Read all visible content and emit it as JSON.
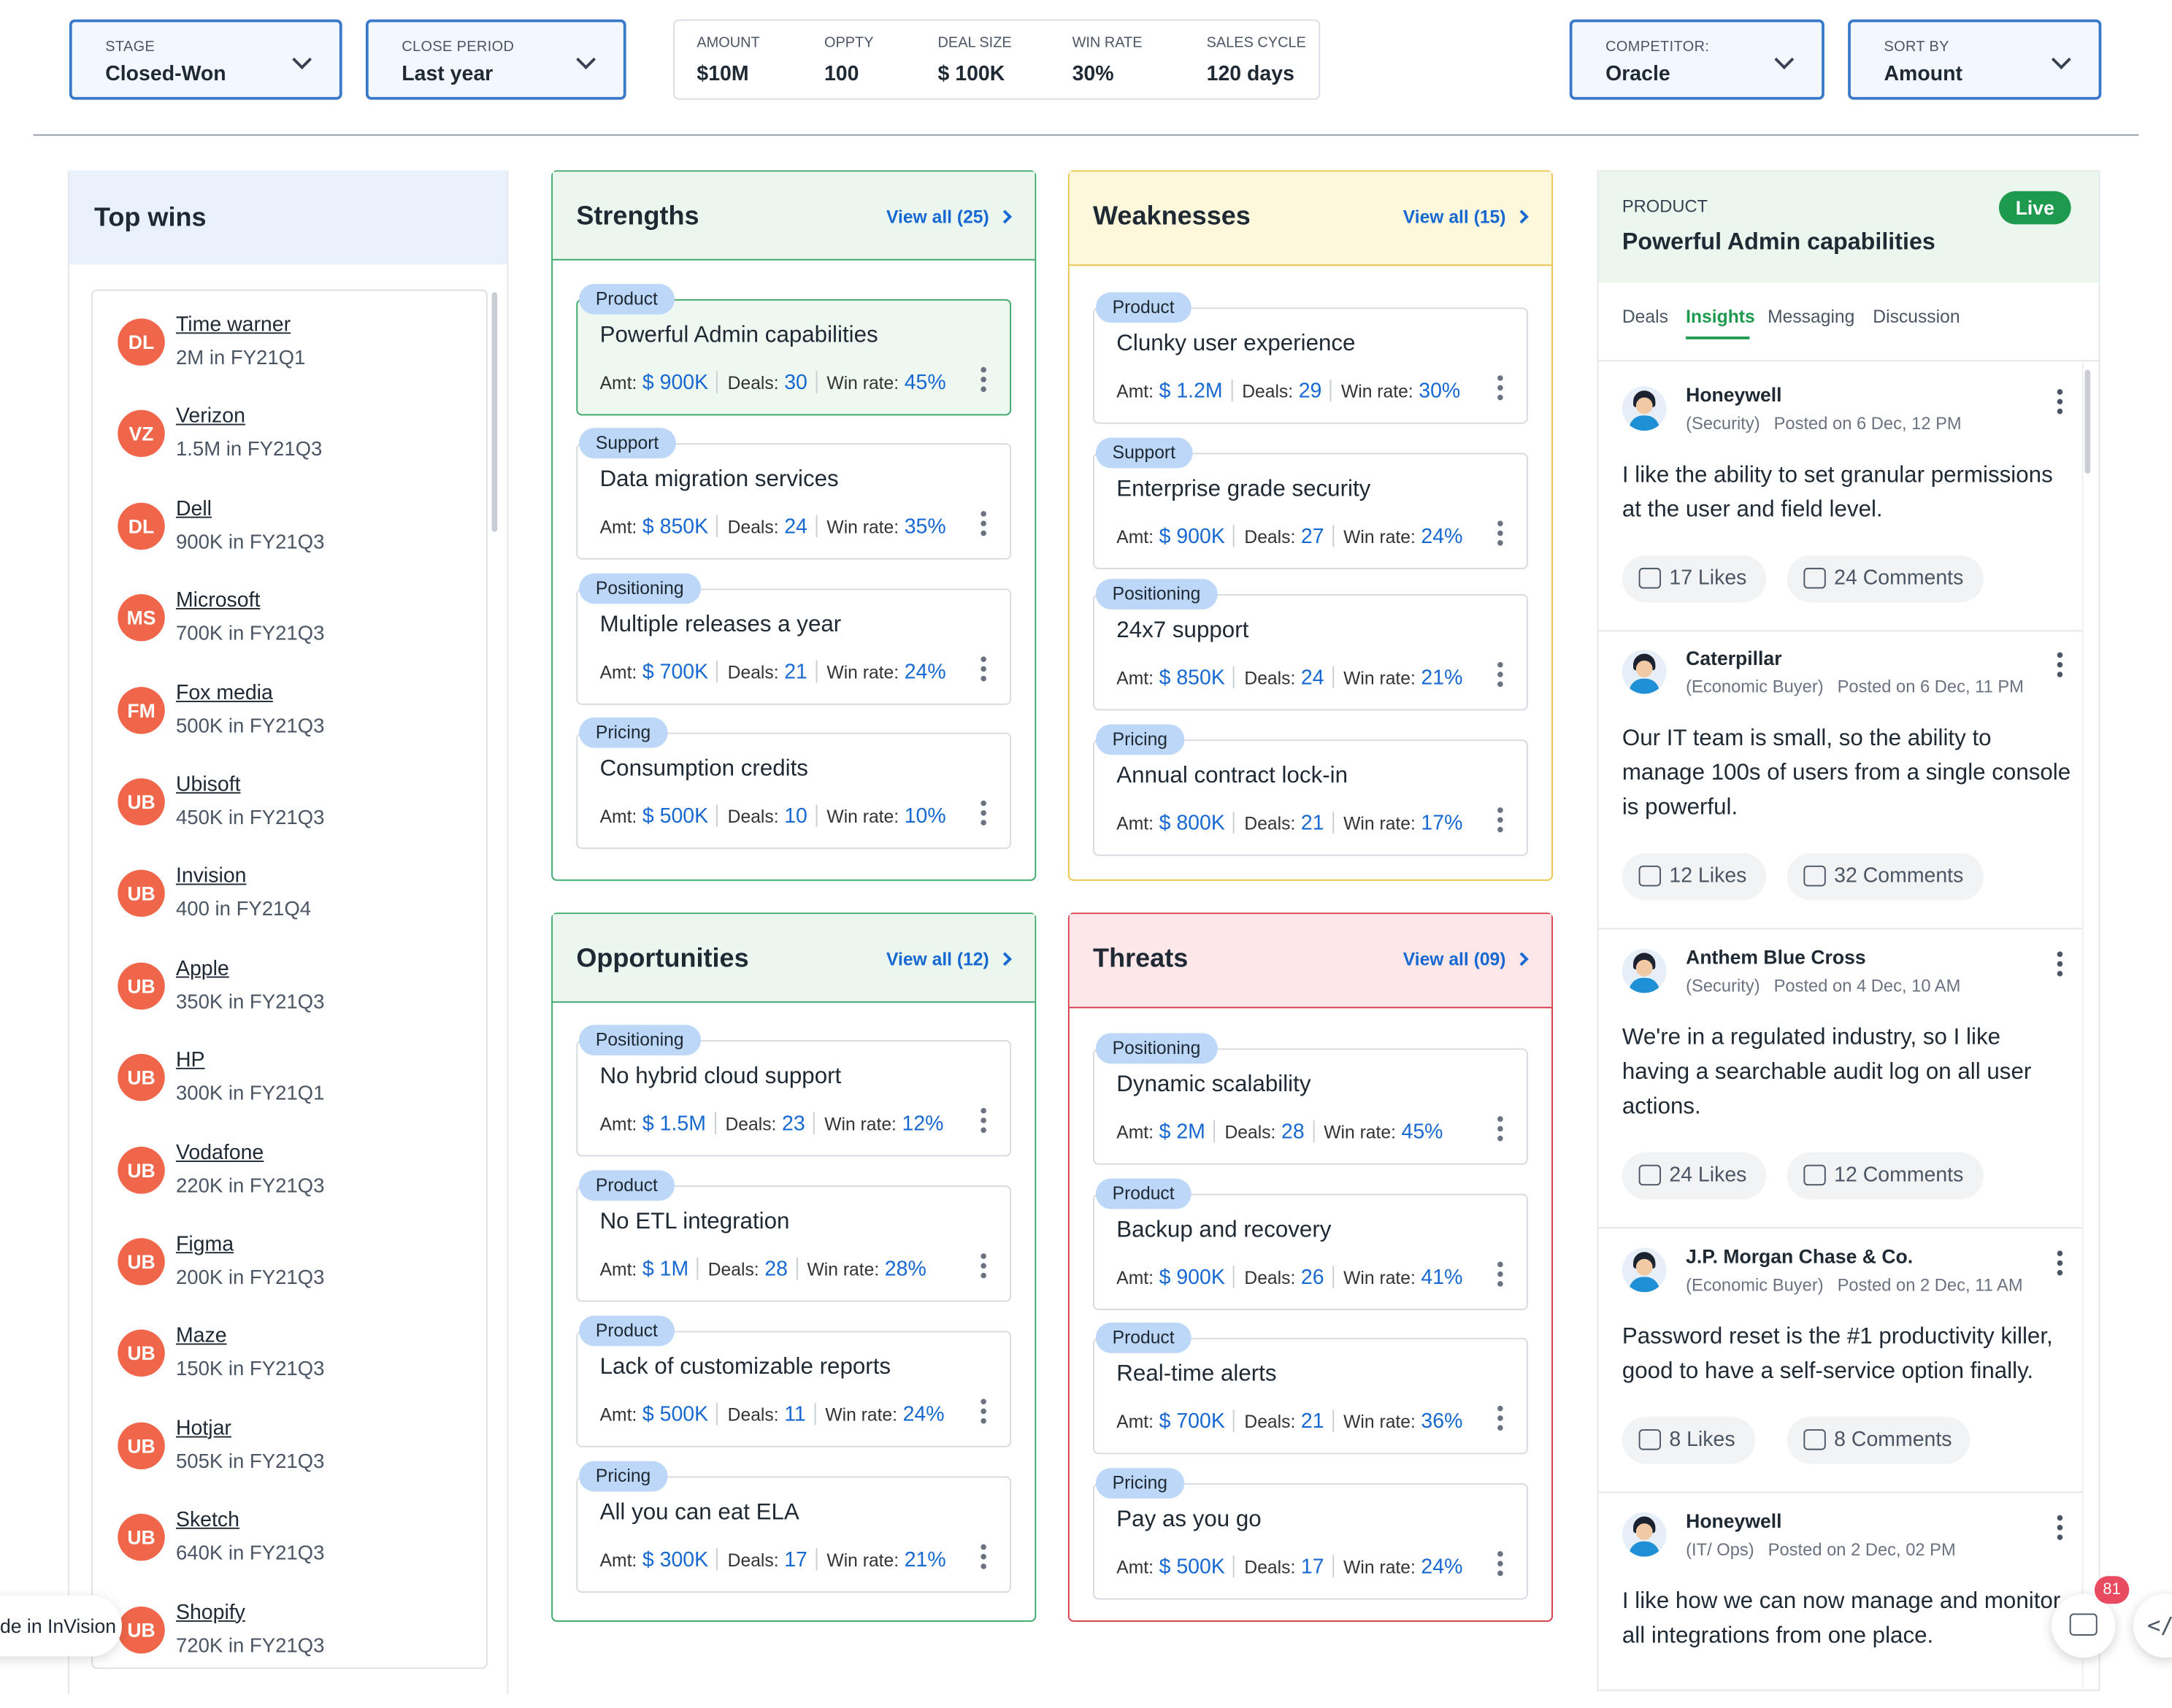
{
  "filters": {
    "stage": {
      "label": "STAGE",
      "value": "Closed-Won"
    },
    "close_period": {
      "label": "CLOSE PERIOD",
      "value": "Last year"
    },
    "competitor": {
      "label": "COMPETITOR:",
      "value": "Oracle"
    },
    "sort_by": {
      "label": "SORT BY",
      "value": "Amount"
    }
  },
  "metrics": [
    {
      "label": "AMOUNT",
      "value": "$10M"
    },
    {
      "label": "OPPTY",
      "value": "100"
    },
    {
      "label": "DEAL SIZE",
      "value": "$ 100K"
    },
    {
      "label": "WIN RATE",
      "value": "30%"
    },
    {
      "label": "SALES CYCLE",
      "value": "120 days"
    }
  ],
  "top_wins": {
    "title": "Top wins",
    "items": [
      {
        "initials": "DL",
        "name": "Time warner",
        "detail": "2M in FY21Q1"
      },
      {
        "initials": "VZ",
        "name": "Verizon",
        "detail": "1.5M in FY21Q3"
      },
      {
        "initials": "DL",
        "name": "Dell",
        "detail": "900K in FY21Q3"
      },
      {
        "initials": "MS",
        "name": "Microsoft",
        "detail": "700K in FY21Q3"
      },
      {
        "initials": "FM",
        "name": "Fox media",
        "detail": "500K in FY21Q3"
      },
      {
        "initials": "UB",
        "name": "Ubisoft",
        "detail": "450K in FY21Q3"
      },
      {
        "initials": "UB",
        "name": "Invision",
        "detail": "400 in FY21Q4"
      },
      {
        "initials": "UB",
        "name": "Apple",
        "detail": "350K in FY21Q3"
      },
      {
        "initials": "UB",
        "name": "HP",
        "detail": "300K in FY21Q1"
      },
      {
        "initials": "UB",
        "name": "Vodafone",
        "detail": "220K in FY21Q3"
      },
      {
        "initials": "UB",
        "name": "Figma",
        "detail": "200K in FY21Q3"
      },
      {
        "initials": "UB",
        "name": "Maze",
        "detail": "150K in FY21Q3"
      },
      {
        "initials": "UB",
        "name": "Hotjar",
        "detail": "505K in FY21Q3"
      },
      {
        "initials": "UB",
        "name": "Sketch",
        "detail": "640K in FY21Q3"
      },
      {
        "initials": "UB",
        "name": "Shopify",
        "detail": "720K in FY21Q3"
      }
    ]
  },
  "card_labels": {
    "amt": "Amt:",
    "deals": "Deals:",
    "win_rate": "Win rate:"
  },
  "panels": {
    "strengths": {
      "title": "Strengths",
      "view_all": "View all (25)",
      "cards": [
        {
          "tag": "Product",
          "title": "Powerful Admin capabilities",
          "amt": "$ 900K",
          "deals": "30",
          "win_rate": "45%"
        },
        {
          "tag": "Support",
          "title": "Data migration services",
          "amt": "$ 850K",
          "deals": "24",
          "win_rate": "35%"
        },
        {
          "tag": "Positioning",
          "title": "Multiple releases a year",
          "amt": "$ 700K",
          "deals": "21",
          "win_rate": "24%"
        },
        {
          "tag": "Pricing",
          "title": "Consumption credits",
          "amt": "$ 500K",
          "deals": "10",
          "win_rate": "10%"
        }
      ]
    },
    "weaknesses": {
      "title": "Weaknesses",
      "view_all": "View all (15)",
      "cards": [
        {
          "tag": "Product",
          "title": "Clunky user experience",
          "amt": "$ 1.2M",
          "deals": "29",
          "win_rate": "30%"
        },
        {
          "tag": "Support",
          "title": "Enterprise grade security",
          "amt": "$ 900K",
          "deals": "27",
          "win_rate": "24%"
        },
        {
          "tag": "Positioning",
          "title": "24x7 support",
          "amt": "$ 850K",
          "deals": "24",
          "win_rate": "21%"
        },
        {
          "tag": "Pricing",
          "title": "Annual contract lock-in",
          "amt": "$ 800K",
          "deals": "21",
          "win_rate": "17%"
        }
      ]
    },
    "opportunities": {
      "title": "Opportunities",
      "view_all": "View all (12)",
      "cards": [
        {
          "tag": "Positioning",
          "title": "No hybrid cloud support",
          "amt": "$ 1.5M",
          "deals": "23",
          "win_rate": "12%"
        },
        {
          "tag": "Product",
          "title": "No ETL integration",
          "amt": "$ 1M",
          "deals": "28",
          "win_rate": "28%"
        },
        {
          "tag": "Product",
          "title": "Lack of customizable reports",
          "amt": "$ 500K",
          "deals": "11",
          "win_rate": "24%"
        },
        {
          "tag": "Pricing",
          "title": "All you can eat ELA",
          "amt": "$ 300K",
          "deals": "17",
          "win_rate": "21%"
        }
      ]
    },
    "threats": {
      "title": "Threats",
      "view_all": "View all (09)",
      "cards": [
        {
          "tag": "Positioning",
          "title": "Dynamic scalability",
          "amt": "$ 2M",
          "deals": "28",
          "win_rate": "45%"
        },
        {
          "tag": "Product",
          "title": "Backup and recovery",
          "amt": "$ 900K",
          "deals": "26",
          "win_rate": "41%"
        },
        {
          "tag": "Product",
          "title": "Real-time alerts",
          "amt": "$ 700K",
          "deals": "21",
          "win_rate": "36%"
        },
        {
          "tag": "Pricing",
          "title": "Pay as you go",
          "amt": "$ 500K",
          "deals": "17",
          "win_rate": "24%"
        }
      ]
    }
  },
  "detail": {
    "category": "PRODUCT",
    "title": "Powerful Admin capabilities",
    "status": "Live",
    "tabs": [
      "Deals",
      "Insights",
      "Messaging",
      "Discussion"
    ],
    "active_tab": "Insights",
    "posts": [
      {
        "author": "Honeywell",
        "role": "(Security)",
        "posted": "Posted on 6 Dec, 12 PM",
        "text": "I like the ability to set granular permissions at the user and field level.",
        "likes": "17 Likes",
        "comments": "24 Comments"
      },
      {
        "author": "Caterpillar",
        "role": "(Economic Buyer)",
        "posted": "Posted on 6 Dec, 11 PM",
        "text": "Our IT team is small, so the ability to manage 100s of users from a single console is powerful.",
        "likes": "12 Likes",
        "comments": "32 Comments"
      },
      {
        "author": "Anthem Blue Cross",
        "role": "(Security)",
        "posted": "Posted on 4 Dec, 10 AM",
        "text": "We're in a regulated industry, so I like having a searchable audit log on all user actions.",
        "likes": "24 Likes",
        "comments": "12 Comments"
      },
      {
        "author": "J.P. Morgan Chase & Co.",
        "role": "(Economic Buyer)",
        "posted": "Posted on 2 Dec, 11 AM",
        "text": "Password reset is the #1 productivity killer, good to have a self-service option finally.",
        "likes": "8 Likes",
        "comments": "8 Comments"
      },
      {
        "author": "Honeywell",
        "role": "(IT/ Ops)",
        "posted": "Posted on 2 Dec, 02 PM",
        "text": "I like how we can now manage and monitor all integrations from one place.",
        "likes": "",
        "comments": ""
      }
    ]
  },
  "floating": {
    "invision_label": "de in InVision",
    "chat_badge": "81",
    "code_glyph": "</"
  },
  "colors": {
    "accent": "#1769d1",
    "strengths": "#3aa86a",
    "weaknesses": "#e9c44a",
    "threats": "#d6394a",
    "avatar": "#f0664a",
    "live": "#1e9a4f"
  }
}
